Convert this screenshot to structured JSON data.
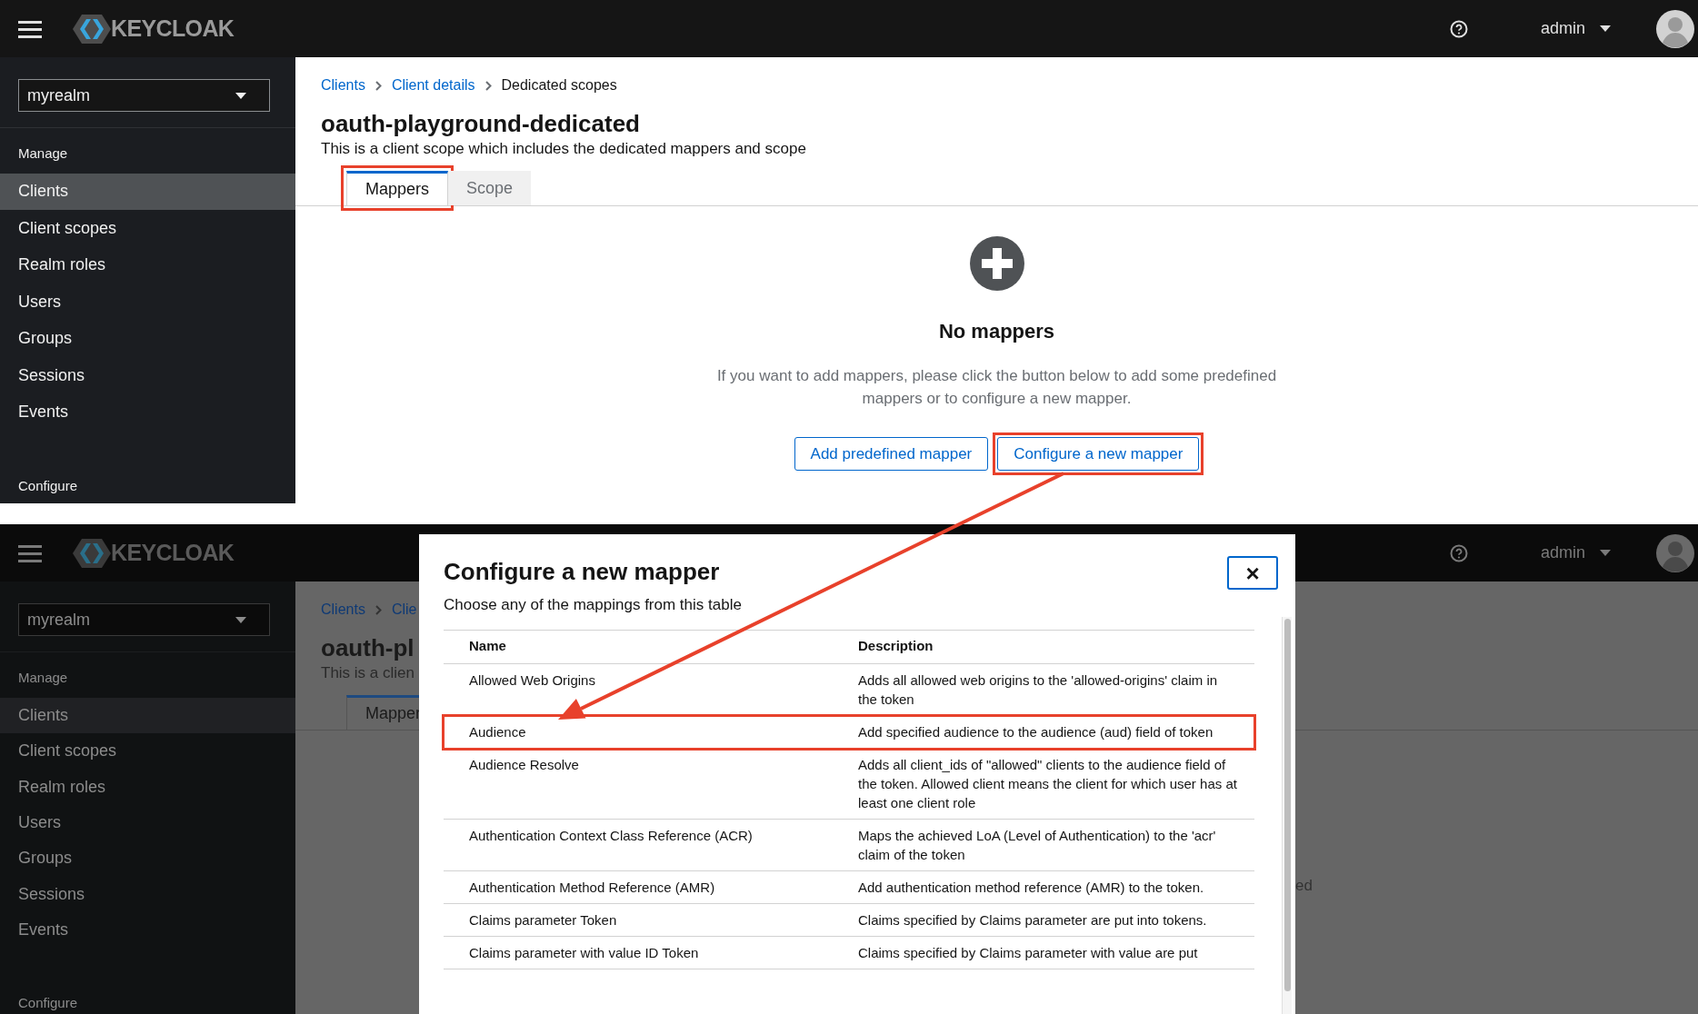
{
  "top_screen": {
    "masthead": {
      "brand": "KEYCLOAK",
      "user": "admin"
    },
    "realm_selector": {
      "value": "myrealm"
    },
    "nav": {
      "manage_heading": "Manage",
      "items": [
        {
          "label": "Clients",
          "selected": true
        },
        {
          "label": "Client scopes",
          "selected": false
        },
        {
          "label": "Realm roles",
          "selected": false
        },
        {
          "label": "Users",
          "selected": false
        },
        {
          "label": "Groups",
          "selected": false
        },
        {
          "label": "Sessions",
          "selected": false
        },
        {
          "label": "Events",
          "selected": false
        }
      ],
      "configure_heading": "Configure"
    },
    "breadcrumb": [
      {
        "label": "Clients",
        "kind": "link"
      },
      {
        "label": "Client details",
        "kind": "link"
      },
      {
        "label": "Dedicated scopes",
        "kind": "current"
      }
    ],
    "title": "oauth-playground-dedicated",
    "description": "This is a client scope which includes the dedicated mappers and scope",
    "tabs": [
      {
        "label": "Mappers",
        "selected": true,
        "highlighted": true
      },
      {
        "label": "Scope",
        "selected": false,
        "highlighted": false
      }
    ],
    "empty_state": {
      "title": "No mappers",
      "text": "If you want to add mappers, please click the button below to add some predefined mappers or to configure a new mapper.",
      "buttons": [
        {
          "label": "Add predefined mapper",
          "highlighted": false
        },
        {
          "label": "Configure a new mapper",
          "highlighted": true
        }
      ]
    }
  },
  "bottom_screen": {
    "masthead": {
      "brand": "KEYCLOAK",
      "user": "admin"
    },
    "realm_selector": {
      "value": "myrealm"
    },
    "nav": {
      "manage_heading": "Manage",
      "items": [
        {
          "label": "Clients",
          "selected": true
        },
        {
          "label": "Client scopes",
          "selected": false
        },
        {
          "label": "Realm roles",
          "selected": false
        },
        {
          "label": "Users",
          "selected": false
        },
        {
          "label": "Groups",
          "selected": false
        },
        {
          "label": "Sessions",
          "selected": false
        },
        {
          "label": "Events",
          "selected": false
        }
      ],
      "configure_heading": "Configure"
    },
    "breadcrumb": [
      {
        "label": "Clients",
        "kind": "link"
      },
      {
        "label": "Clie",
        "kind": "link"
      }
    ],
    "title": "oauth-pl",
    "description": "This is a clien",
    "tabs": [
      {
        "label": "Mapper",
        "selected": true
      }
    ],
    "partial_text": "ed"
  },
  "dialog": {
    "title": "Configure a new mapper",
    "subtitle": "Choose any of the mappings from this table",
    "close": "×",
    "columns": [
      "Name",
      "Description"
    ],
    "rows": [
      {
        "name": "Allowed Web Origins",
        "description": "Adds all allowed web origins to the 'allowed-origins' claim in the token",
        "highlighted": false
      },
      {
        "name": "Audience",
        "description": "Add specified audience to the audience (aud) field of token",
        "highlighted": true
      },
      {
        "name": "Audience Resolve",
        "description": "Adds all client_ids of \"allowed\" clients to the audience field of the token. Allowed client means the client for which user has at least one client role",
        "highlighted": false
      },
      {
        "name": "Authentication Context Class Reference (ACR)",
        "description": "Maps the achieved LoA (Level of Authentication) to the 'acr' claim of the token",
        "highlighted": false
      },
      {
        "name": "Authentication Method Reference (AMR)",
        "description": "Add authentication method reference (AMR) to the token.",
        "highlighted": false
      },
      {
        "name": "Claims parameter Token",
        "description": "Claims specified by Claims parameter are put into tokens.",
        "highlighted": false
      },
      {
        "name": "Claims parameter with value ID Token",
        "description": "Claims specified by Claims parameter with value are put",
        "highlighted": false
      }
    ]
  }
}
